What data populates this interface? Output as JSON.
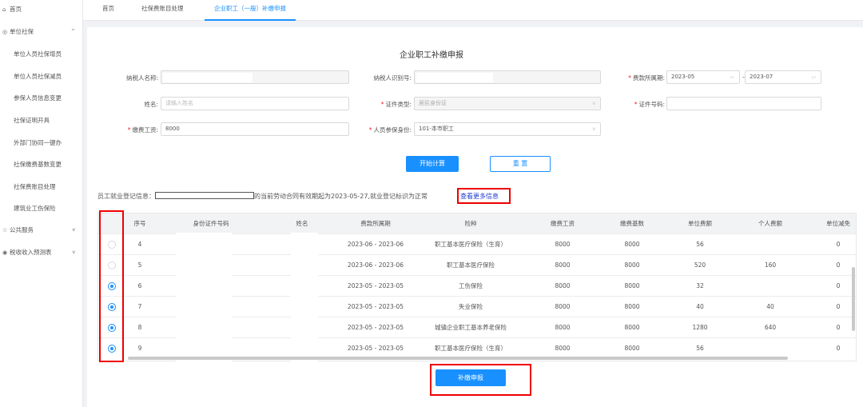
{
  "sidebar": {
    "home": "首页",
    "unit_social": "单位社保",
    "sub_items": [
      "单位人员社保增员",
      "单位人员社保减员",
      "参保人员信息变更",
      "社保证明开具",
      "外部门协同一键办",
      "社保缴费基数变更",
      "社保费账目处理",
      "建筑业工伤保险"
    ],
    "public_service": "公共服务",
    "tax_forecast": "税收收入预测表"
  },
  "tabs": [
    "首页",
    "社保费账目处理",
    "企业职工（一般）补缴申报"
  ],
  "form": {
    "title": "企业职工补缴申报",
    "taxpayer_name_label": "纳税人名称:",
    "taxpayer_id_label": "纳税人识别号:",
    "period_label": "费款所属期:",
    "period_start": "2023-05",
    "period_end": "2023-07",
    "name_label": "姓名:",
    "name_placeholder": "请输入姓名",
    "cert_type_label": "证件类型:",
    "cert_type_value": "居民身份证",
    "cert_no_label": "证件号码:",
    "wage_label": "缴费工资:",
    "wage_value": "8000",
    "identity_label": "人员参保身份:",
    "identity_value": "101-本市职工",
    "calc_button": "开始计算",
    "reset_button": "重 置"
  },
  "info": {
    "prefix": "员工就业登记信息：",
    "suffix": "的当前劳动合同有效期起为2023-05-27,就业登记标识为正常",
    "link": "查看更多信息"
  },
  "table": {
    "headers": [
      "序号",
      "身份证件号码",
      "姓名",
      "费款所属期",
      "险种",
      "缴费工资",
      "缴费基数",
      "单位费额",
      "个人费额",
      "单位减免"
    ],
    "rows": [
      {
        "selected": false,
        "no": "4",
        "period": "2023-06 - 2023-06",
        "type": "职工基本医疗保险（生育）",
        "wage": "8000",
        "base": "8000",
        "unit_fee": "56",
        "personal_fee": "",
        "reduce": "0"
      },
      {
        "selected": false,
        "no": "5",
        "period": "2023-06 - 2023-06",
        "type": "职工基本医疗保险",
        "wage": "8000",
        "base": "8000",
        "unit_fee": "520",
        "personal_fee": "160",
        "reduce": "0"
      },
      {
        "selected": true,
        "no": "6",
        "period": "2023-05 - 2023-05",
        "type": "工伤保险",
        "wage": "8000",
        "base": "8000",
        "unit_fee": "32",
        "personal_fee": "",
        "reduce": "0"
      },
      {
        "selected": true,
        "no": "7",
        "period": "2023-05 - 2023-05",
        "type": "失业保险",
        "wage": "8000",
        "base": "8000",
        "unit_fee": "40",
        "personal_fee": "40",
        "reduce": "0"
      },
      {
        "selected": true,
        "no": "8",
        "period": "2023-05 - 2023-05",
        "type": "城镇企业职工基本养老保险",
        "wage": "8000",
        "base": "8000",
        "unit_fee": "1280",
        "personal_fee": "640",
        "reduce": "0"
      },
      {
        "selected": true,
        "no": "9",
        "period": "2023-05 - 2023-05",
        "type": "职工基本医疗保险（生育）",
        "wage": "8000",
        "base": "8000",
        "unit_fee": "56",
        "personal_fee": "",
        "reduce": "0"
      }
    ]
  },
  "submit_button": "补缴申报",
  "colors": {
    "accent": "#1890ff",
    "highlight": "#e00000"
  }
}
